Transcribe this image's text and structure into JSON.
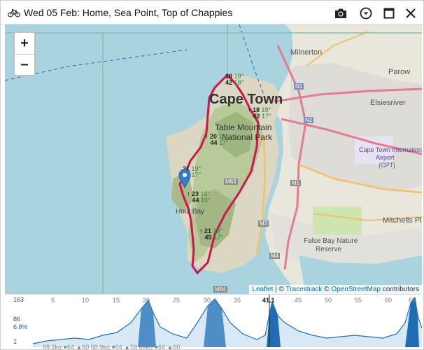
{
  "window": {
    "title": "Wed 05 Feb: Home, Sea Point, Top of Chappies",
    "buttons": [
      "camera-icon",
      "dropdown-icon",
      "maximize-icon",
      "close-icon"
    ]
  },
  "map": {
    "zoom_in": "+",
    "zoom_out": "−",
    "labels": {
      "milnerton": "Milnerton",
      "parow": "Parow",
      "elsiesriver": "Elsiesriver",
      "cape_town": "Cape Town",
      "table_mountain_1": "Table Mountain",
      "table_mountain_2": "National Park",
      "airport_1": "Cape Town International",
      "airport_2": "Airport",
      "airport_3": "(CPT)",
      "false_bay_1": "False Bay Nature",
      "false_bay_2": "Reserve",
      "mitchells": "Mitchells Pla",
      "hout_bay": "Hout Bay",
      "n1": "N1",
      "n2": "N2",
      "m5": "M5",
      "m63": "M63",
      "m3": "M3",
      "m4": "M4",
      "m64": "M64"
    },
    "weather_markers": [
      {
        "a": "18",
        "b": "19°",
        "c": "42",
        "d": "18°"
      },
      {
        "a": "18",
        "b": "19°",
        "c": "42",
        "d": "17°"
      },
      {
        "a": "20",
        "b": "19°",
        "c": "44",
        "d": "17°"
      },
      {
        "a": "21",
        "b": "19°",
        "c": "45",
        "d": "17°"
      },
      {
        "a": "23",
        "b": "18°",
        "c": "44",
        "d": "16°"
      },
      {
        "a": "21",
        "b": "19°",
        "c": "45",
        "d": "17°"
      }
    ],
    "attribution": {
      "leaflet": "Leaflet",
      "sep1": " | © ",
      "tracestrack": "Tracestrack",
      "sep2": " © ",
      "osm": "OpenStreetMap",
      "contributors": " contributors"
    }
  },
  "profile": {
    "ticks": [
      "5",
      "10",
      "15",
      "20",
      "25",
      "30",
      "35",
      "41.1",
      "45",
      "50",
      "55",
      "60",
      "65"
    ],
    "y_top": "163",
    "y_mid": "86",
    "grade": "6.8%",
    "y_bottom": "1",
    "accent": "#1f6db5"
  },
  "bottom_strip": "69.2kg   ♥64   ▲60      68.9kg   ♥64   ▲59      69kg   ♥64   ▲60"
}
